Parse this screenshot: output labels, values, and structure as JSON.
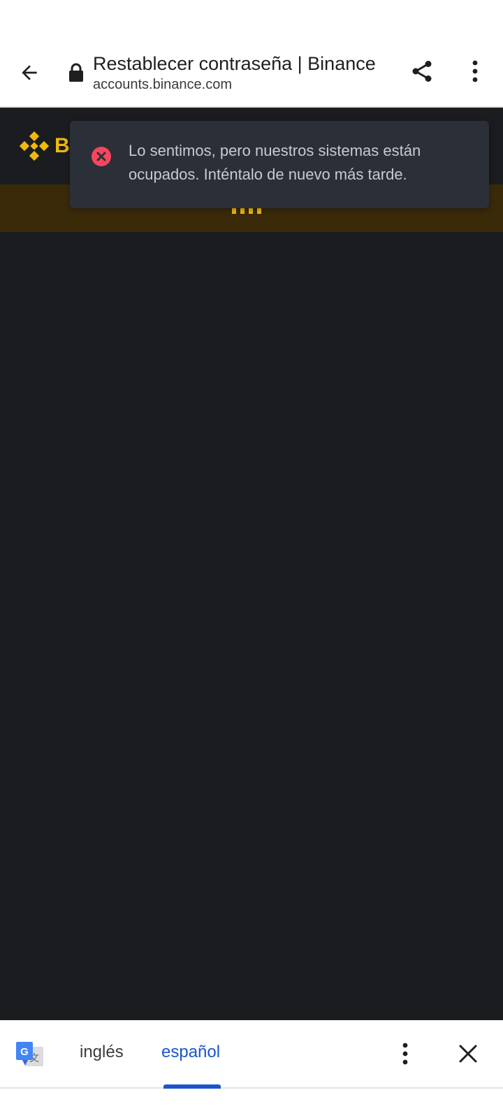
{
  "browser": {
    "page_title": "Restablecer contraseña | Binance",
    "url": "accounts.binance.com",
    "icons": {
      "back": "back-arrow-icon",
      "lock": "lock-icon",
      "share": "share-icon",
      "menu": "more-vert-icon"
    }
  },
  "site": {
    "logo_text": "B",
    "brand_color": "#f0b90b",
    "background_color": "#1b1c20"
  },
  "toast": {
    "message": "Lo sentimos, pero nuestros sistemas están ocupados. Inténtalo de nuevo más tarde.",
    "icon": "error-circle-icon",
    "icon_color": "#f6465d"
  },
  "translate_bar": {
    "source_language": "inglés",
    "target_language": "español",
    "active_language": "español",
    "accent_color": "#1a56c9",
    "icons": {
      "logo": "google-translate-icon",
      "menu": "more-vert-icon",
      "close": "close-icon"
    }
  }
}
